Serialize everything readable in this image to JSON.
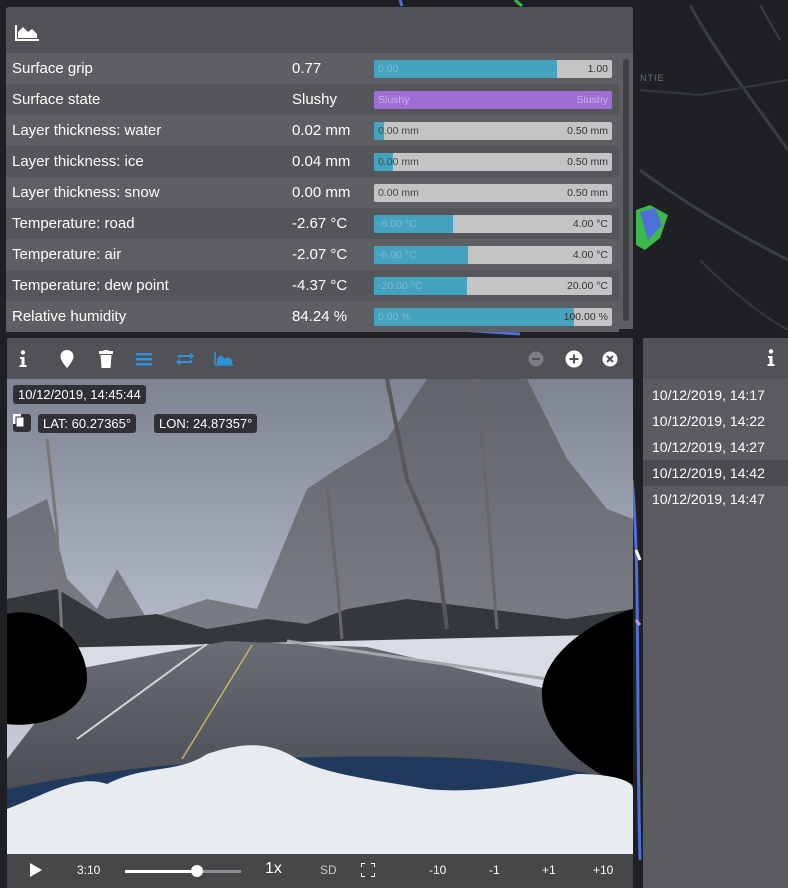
{
  "map": {
    "label": "NTIE"
  },
  "data_panel": {
    "header_icon": "area-chart-icon",
    "rows": [
      {
        "label": "Surface grip",
        "value": "0.77",
        "min": "0.00",
        "max": "1.00",
        "fill": 0.77,
        "style": "blue"
      },
      {
        "label": "Surface state",
        "value": "Slushy",
        "min": "Slushy",
        "max": "Slushy",
        "fill": 1.0,
        "style": "purple"
      },
      {
        "label": "Layer thickness: water",
        "value": "0.02 mm",
        "min": "0.00 mm",
        "max": "0.50 mm",
        "fill": 0.04,
        "style": "light"
      },
      {
        "label": "Layer thickness: ice",
        "value": "0.04 mm",
        "min": "0.00 mm",
        "max": "0.50 mm",
        "fill": 0.08,
        "style": "light"
      },
      {
        "label": "Layer thickness: snow",
        "value": "0.00 mm",
        "min": "0.00 mm",
        "max": "0.50 mm",
        "fill": 0.0,
        "style": "light"
      },
      {
        "label": "Temperature: road",
        "value": "-2.67 °C",
        "min": "-6.00 °C",
        "max": "4.00 °C",
        "fill": 0.333,
        "style": "blue"
      },
      {
        "label": "Temperature: air",
        "value": "-2.07 °C",
        "min": "-6.00 °C",
        "max": "4.00 °C",
        "fill": 0.393,
        "style": "blue"
      },
      {
        "label": "Temperature: dew point",
        "value": "-4.37 °C",
        "min": "-20.00 °C",
        "max": "20.00 °C",
        "fill": 0.391,
        "style": "blue"
      },
      {
        "label": "Relative humidity",
        "value": "84.24 %",
        "min": "0.00 %",
        "max": "100.00 %",
        "fill": 0.842,
        "style": "blue"
      }
    ]
  },
  "video": {
    "timestamp": "10/12/2019, 14:45:44",
    "lat": "LAT: 60.27365°",
    "lon": "LON: 24.87357°",
    "controls": {
      "time": "3:10",
      "progress": 0.62,
      "speed": "1x",
      "quality": "SD",
      "skip_minus_10": "-10",
      "skip_minus_1": "-1",
      "skip_plus_1": "+1",
      "skip_plus_10": "+10"
    },
    "toolbar_icons": [
      "info-icon",
      "map-marker-icon",
      "trash-icon",
      "list-icon",
      "repeat-icon",
      "area-chart-icon",
      "zoom-out-icon",
      "zoom-in-icon",
      "close-icon"
    ]
  },
  "timestamps": {
    "items": [
      "10/12/2019, 14:17",
      "10/12/2019, 14:22",
      "10/12/2019, 14:27",
      "10/12/2019, 14:42",
      "10/12/2019, 14:47"
    ],
    "selected_index": 3
  },
  "colors": {
    "accent": "#44a4c0",
    "purple": "#9d6fd4",
    "panel": "#5d5f62"
  }
}
